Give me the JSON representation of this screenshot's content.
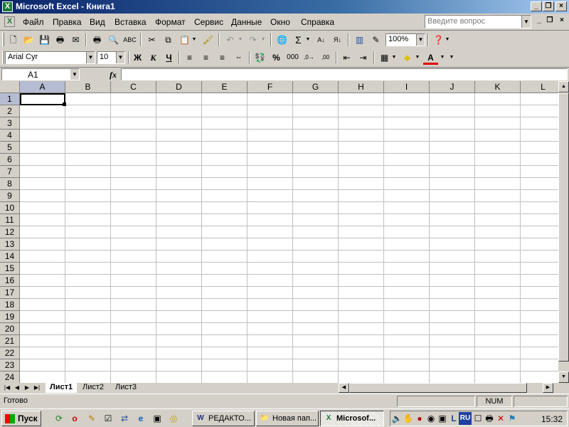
{
  "window": {
    "title": "Microsoft Excel - Книга1",
    "app_icon": "excel-icon"
  },
  "menu": {
    "items": [
      "Файл",
      "Правка",
      "Вид",
      "Вставка",
      "Формат",
      "Сервис",
      "Данные",
      "Окно",
      "Справка"
    ],
    "ask_placeholder": "Введите вопрос"
  },
  "toolbar_standard": {
    "zoom": "100%"
  },
  "toolbar_format": {
    "font": "Arial Cyr",
    "size": "10",
    "bold": "Ж",
    "italic": "К",
    "underline": "Ч"
  },
  "formula": {
    "name_box": "A1",
    "fx": "fx",
    "value": ""
  },
  "grid": {
    "columns": [
      "A",
      "B",
      "C",
      "D",
      "E",
      "F",
      "G",
      "H",
      "I",
      "J",
      "K",
      "L"
    ],
    "rows": [
      "1",
      "2",
      "3",
      "4",
      "5",
      "6",
      "7",
      "8",
      "9",
      "10",
      "11",
      "12",
      "13",
      "14",
      "15",
      "16",
      "17",
      "18",
      "19",
      "20",
      "21",
      "22",
      "23",
      "24"
    ],
    "active_cell": "A1"
  },
  "sheets": {
    "tabs": [
      "Лист1",
      "Лист2",
      "Лист3"
    ],
    "active": "Лист1"
  },
  "status": {
    "left": "Готово",
    "num": "NUM"
  },
  "taskbar": {
    "start": "Пуск",
    "tasks": [
      "РЕДАКТО...",
      "Новая пап...",
      "Microsof..."
    ],
    "lang": "RU",
    "clock": "15:32"
  }
}
